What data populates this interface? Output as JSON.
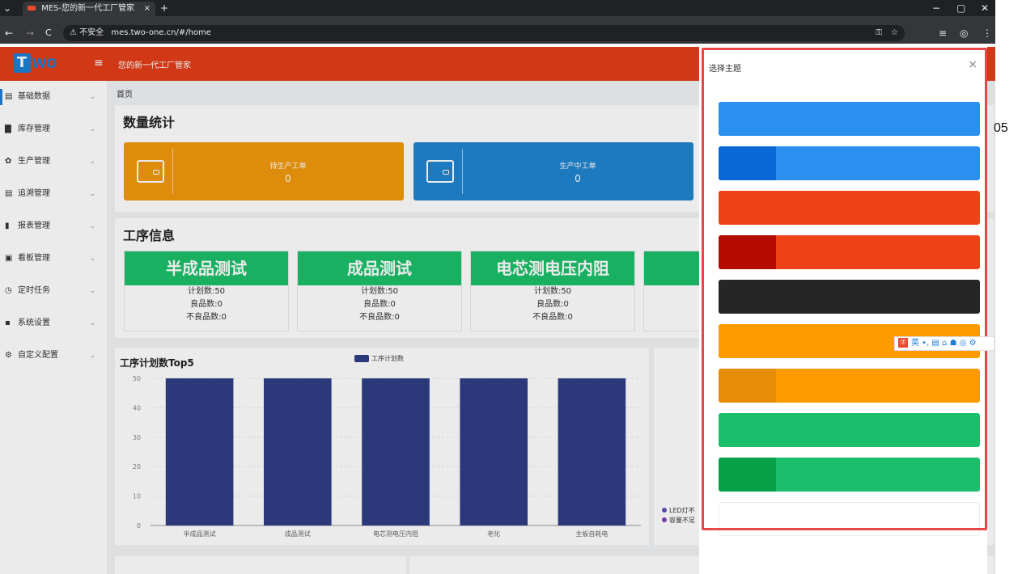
{
  "browser": {
    "tab_title": "MES-您的新一代工厂管家",
    "tab_close": "×",
    "new_tab": "+",
    "insecure_label": "⚠ 不安全",
    "url": "mes.two-one.cn/#/home",
    "back": "←",
    "forward": "→",
    "reload": "C",
    "minimize": "−",
    "restore": "▢",
    "close": "✕",
    "menu": "⋮",
    "star": "☆",
    "key": "⚿",
    "list": "≡",
    "profile": "◎"
  },
  "app": {
    "logo_t": "T",
    "logo_wo": "wo",
    "menu_icon": "≡",
    "subtitle": "您的新一代工厂管家"
  },
  "sidebar": {
    "items": [
      {
        "icon": "▤",
        "label": "基础数据",
        "chev": "⌄"
      },
      {
        "icon": "▇",
        "label": "库存管理",
        "chev": "⌄"
      },
      {
        "icon": "✿",
        "label": "生产管理",
        "chev": "⌄"
      },
      {
        "icon": "▤",
        "label": "追溯管理",
        "chev": "⌄"
      },
      {
        "icon": "▮",
        "label": "报表管理",
        "chev": "⌄"
      },
      {
        "icon": "▣",
        "label": "看板管理",
        "chev": "⌄"
      },
      {
        "icon": "◷",
        "label": "定时任务",
        "chev": "⌄"
      },
      {
        "icon": "▪",
        "label": "系统设置",
        "chev": "⌄"
      },
      {
        "icon": "⚙",
        "label": "自定义配置",
        "chev": "⌄"
      }
    ]
  },
  "breadcrumb": "首页",
  "stats": {
    "title": "数量统计",
    "cards": [
      {
        "label": "待生产工单",
        "value": "0",
        "color": "#f09a0d"
      },
      {
        "label": "生产中工单",
        "value": "0",
        "color": "#2185d0"
      }
    ]
  },
  "process": {
    "title": "工序信息",
    "items": [
      {
        "name": "半成品测试",
        "plan": "计划数:50",
        "good": "良品数:0",
        "bad": "不良品数:0"
      },
      {
        "name": "成品测试",
        "plan": "计划数:50",
        "good": "良品数:0",
        "bad": "不良品数:0"
      },
      {
        "name": "电芯测电压内阻",
        "plan": "计划数:50",
        "good": "良品数:0",
        "bad": "不良品数:0"
      },
      {
        "name": "",
        "plan": "",
        "good": "",
        "bad": ""
      }
    ]
  },
  "chart_data": {
    "type": "bar",
    "title": "工序计划数Top5",
    "categories": [
      "半成品测试",
      "成品测试",
      "电芯测电压内阻",
      "老化",
      "主板自耗电"
    ],
    "series": [
      {
        "name": "工序计划数",
        "values": [
          50,
          50,
          50,
          50,
          50
        ],
        "color": "#2f3e86"
      }
    ],
    "yticks": [
      0,
      10,
      20,
      30,
      40,
      50
    ],
    "ylim": [
      0,
      50
    ],
    "legend": "top"
  },
  "pie_legend": [
    {
      "label": "LED灯不"
    },
    {
      "label": "容量不足"
    }
  ],
  "drawer": {
    "title": "选择主题",
    "close": "×",
    "themes": [
      {
        "left": "#2b8ff0",
        "main": "#2b8ff0"
      },
      {
        "left": "#0a68d6",
        "main": "#2b8ff0"
      },
      {
        "left": "#ef4317",
        "main": "#ef4317"
      },
      {
        "left": "#b40a00",
        "main": "#ef4317"
      },
      {
        "left": "#262626",
        "main": "#262626"
      },
      {
        "left": "#fd9a00",
        "main": "#fd9a00"
      },
      {
        "left": "#e68c06",
        "main": "#fd9a00"
      },
      {
        "left": "#1bbe6a",
        "main": "#1bbe6a"
      },
      {
        "left": "#06a049",
        "main": "#1bbe6a"
      },
      {
        "left": "#ffffff",
        "main": "#ffffff"
      }
    ]
  },
  "ime": {
    "badge": "⑦",
    "text": "英 •, ▤ ⌂ ☗ ◎ ⚙"
  },
  "side_note": "05"
}
